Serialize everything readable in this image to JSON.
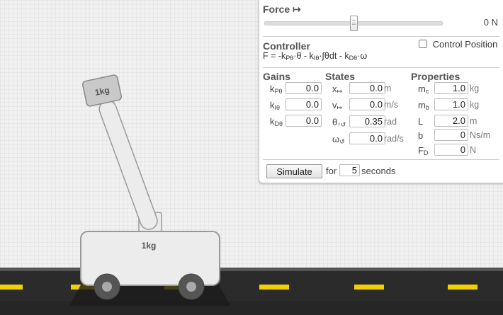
{
  "force": {
    "title": "Force",
    "arrow": "↦",
    "value": "0 N",
    "slider_fraction": 0.5
  },
  "controller": {
    "title": "Controller",
    "formula": "F = -kPθ·θ - kIθ·∫θdt - kDθ·ω",
    "formula_parts": {
      "lead": "F = ",
      "p1": "-k",
      "s1": "Pθ",
      "p2": "·θ - k",
      "s2": "Iθ",
      "p3": "·∫θdt - k",
      "s3": "Dθ",
      "p4": "·ω"
    },
    "control_position_label": "Control Position",
    "control_position_checked": false
  },
  "gains": {
    "title": "Gains",
    "rows": [
      {
        "k": "k",
        "sub": "Pθ",
        "value": "0.0"
      },
      {
        "k": "k",
        "sub": "Iθ",
        "value": "0.0"
      },
      {
        "k": "k",
        "sub": "Dθ",
        "value": "0.0"
      }
    ]
  },
  "states": {
    "title": "States",
    "rows": [
      {
        "sym": "x",
        "sub": "↦",
        "value": "0.0",
        "unit": "m"
      },
      {
        "sym": "v",
        "sub": "↦",
        "value": "0.0",
        "unit": "m/s"
      },
      {
        "sym": "θ",
        "sub": "↑↺",
        "value": "0.35",
        "unit": "rad"
      },
      {
        "sym": "ω",
        "sub": "↺",
        "value": "0.0",
        "unit": "rad/s"
      }
    ]
  },
  "properties": {
    "title": "Properties",
    "rows": [
      {
        "sym": "m",
        "sub": "c",
        "value": "1.0",
        "unit": "kg"
      },
      {
        "sym": "m",
        "sub": "b",
        "value": "1.0",
        "unit": "kg"
      },
      {
        "sym": "L",
        "sub": "",
        "value": "2.0",
        "unit": "m"
      },
      {
        "sym": "b",
        "sub": "",
        "value": "0",
        "unit": "Ns/m"
      },
      {
        "sym": "F",
        "sub": "D",
        "value": "0",
        "unit": "N"
      }
    ]
  },
  "simulate": {
    "button_label": "Simulate",
    "for_label": "for",
    "seconds_value": "5",
    "seconds_label": "seconds"
  },
  "scene": {
    "pendulum_mass_label": "1kg",
    "cart_mass_label": "1kg",
    "road_color": "#2b2b2b",
    "lane_marking_color": "#f3d000"
  }
}
